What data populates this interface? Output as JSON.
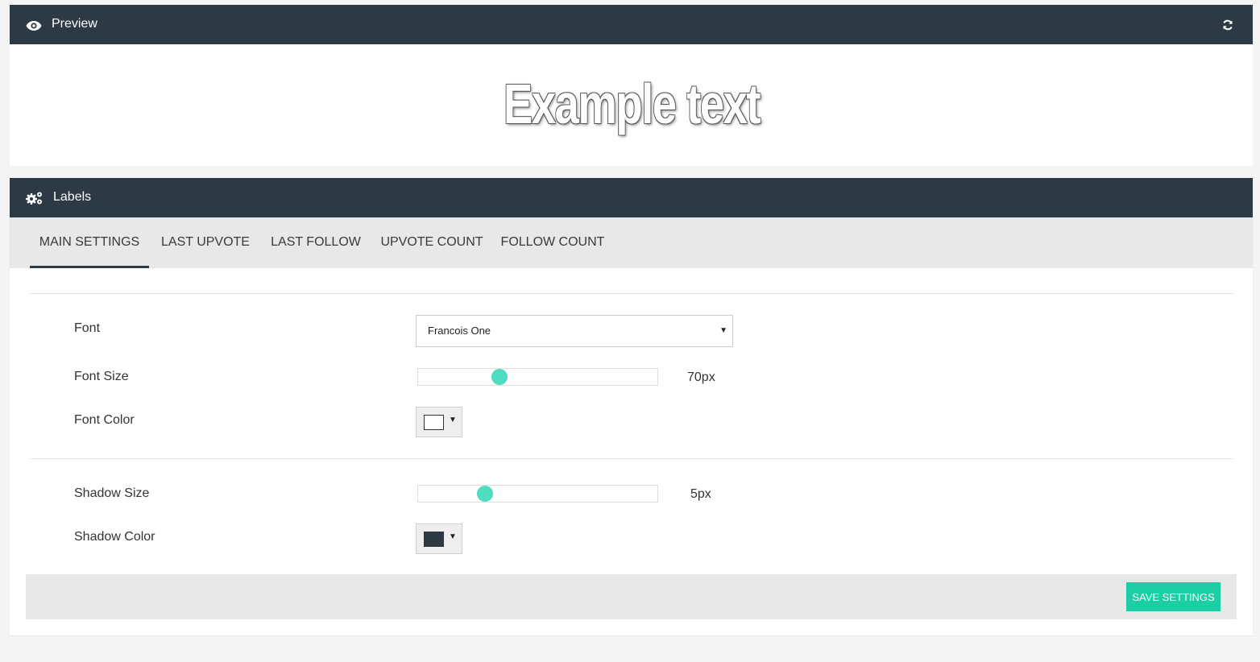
{
  "preview": {
    "title": "Preview",
    "example_text": "Example text"
  },
  "labels": {
    "title": "Labels",
    "tabs": [
      {
        "label": "MAIN SETTINGS",
        "active": true
      },
      {
        "label": "LAST UPVOTE",
        "active": false
      },
      {
        "label": "LAST FOLLOW",
        "active": false
      },
      {
        "label": "UPVOTE COUNT",
        "active": false
      },
      {
        "label": "FOLLOW COUNT",
        "active": false
      }
    ],
    "settings": {
      "font_label": "Font",
      "font_value": "Francois One",
      "font_size_label": "Font Size",
      "font_size_value": "70px",
      "font_size_fraction": 0.34,
      "font_color_label": "Font Color",
      "font_color": "#ffffff",
      "shadow_size_label": "Shadow Size",
      "shadow_size_value": "5px",
      "shadow_size_fraction": 0.28,
      "shadow_color_label": "Shadow Color",
      "shadow_color": "#2d3a46"
    },
    "save_label": "SAVE SETTINGS"
  },
  "icons": {
    "preview": "eye-icon",
    "refresh": "refresh-icon",
    "labels": "cogs-icon"
  },
  "colors": {
    "header_bg": "#2d3a46",
    "accent": "#1bcea4",
    "slider_thumb": "#4fdcbf"
  }
}
